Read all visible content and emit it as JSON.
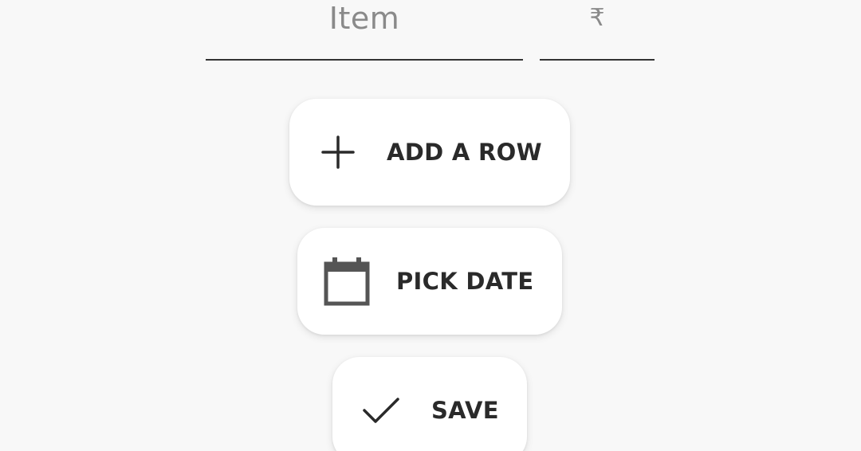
{
  "form": {
    "item_placeholder": "Item",
    "price_placeholder": "₹"
  },
  "buttons": {
    "add_row": {
      "label": "ADD A ROW",
      "icon": "plus-icon"
    },
    "pick_date": {
      "label": "PICK DATE",
      "icon": "calendar-icon"
    },
    "save": {
      "label": "SAVE",
      "icon": "check-icon"
    }
  },
  "colors": {
    "background": "#f8f8f8",
    "button_bg": "#ffffff",
    "text": "#2a2a2a",
    "placeholder": "#8a8a8a",
    "underline": "#333333"
  }
}
